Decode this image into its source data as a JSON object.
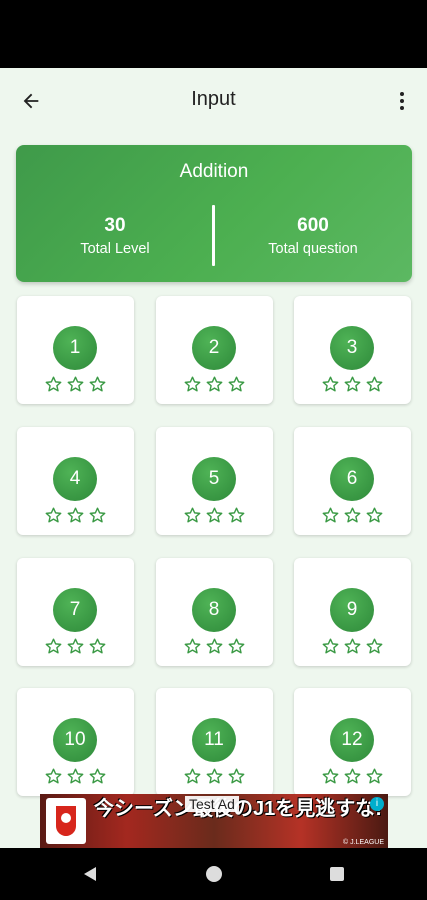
{
  "toolbar": {
    "title": "Input",
    "back_icon": "arrow-left-icon",
    "menu_icon": "more-vert-icon"
  },
  "summary": {
    "title": "Addition",
    "total_level_value": "30",
    "total_level_label": "Total Level",
    "total_question_value": "600",
    "total_question_label": "Total question"
  },
  "levels": [
    {
      "number": "1",
      "stars": 0
    },
    {
      "number": "2",
      "stars": 0
    },
    {
      "number": "3",
      "stars": 0
    },
    {
      "number": "4",
      "stars": 0
    },
    {
      "number": "5",
      "stars": 0
    },
    {
      "number": "6",
      "stars": 0
    },
    {
      "number": "7",
      "stars": 0
    },
    {
      "number": "8",
      "stars": 0
    },
    {
      "number": "9",
      "stars": 0
    },
    {
      "number": "10",
      "stars": 0
    },
    {
      "number": "11",
      "stars": 0
    },
    {
      "number": "12",
      "stars": 0
    }
  ],
  "ad": {
    "label": "Test Ad",
    "text": "今シーズン最後のJ1を見逃すな!",
    "copyright": "© J.LEAGUE"
  },
  "colors": {
    "accent": "#4caf50",
    "accent_dark": "#3b9a45",
    "background": "#eef7ee"
  }
}
